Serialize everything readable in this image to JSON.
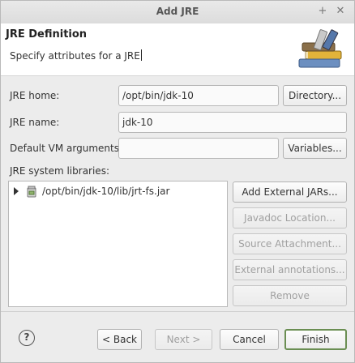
{
  "window": {
    "title": "Add JRE",
    "minimize_label": "+",
    "close_label": "✕"
  },
  "header": {
    "title": "JRE Definition",
    "message": "Specify attributes for a JRE",
    "image_icon": "books-icon"
  },
  "form": {
    "jre_home": {
      "label": "JRE home:",
      "value": "/opt/bin/jdk-10",
      "button": "Directory..."
    },
    "jre_name": {
      "label": "JRE name:",
      "value": "jdk-10"
    },
    "vm_args": {
      "label": "Default VM arguments:",
      "value": "",
      "button": "Variables..."
    }
  },
  "libraries": {
    "label": "JRE system libraries:",
    "items": [
      {
        "path": "/opt/bin/jdk-10/lib/jrt-fs.jar",
        "icon": "jar-icon",
        "expanded": false
      }
    ],
    "buttons": {
      "add_external": "Add External JARs...",
      "javadoc": "Javadoc Location...",
      "source": "Source Attachment...",
      "annotations": "External annotations...",
      "remove": "Remove"
    }
  },
  "footer": {
    "help_label": "?",
    "back": "< Back",
    "next": "Next >",
    "cancel": "Cancel",
    "finish": "Finish"
  }
}
